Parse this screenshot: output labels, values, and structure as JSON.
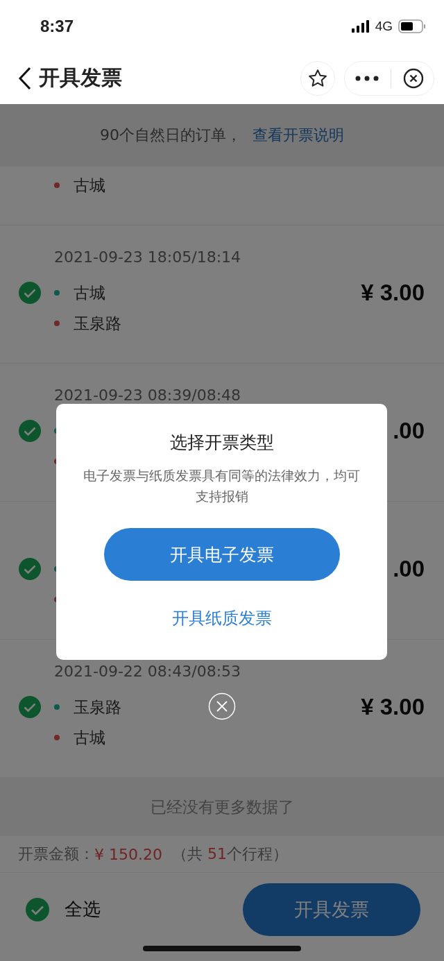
{
  "status_bar": {
    "time": "8:37",
    "network": "4G"
  },
  "nav": {
    "title": "开具发票"
  },
  "notice": {
    "text": "90个自然日的订单，",
    "link": "查看开票说明"
  },
  "trips": [
    {
      "stops": [
        {
          "kind": "end",
          "name": "古城"
        }
      ]
    },
    {
      "checked": true,
      "date": "2021-09-23 18:05/18:14",
      "stops": [
        {
          "kind": "start",
          "name": "古城"
        },
        {
          "kind": "end",
          "name": "玉泉路"
        }
      ],
      "price": "¥ 3.00"
    },
    {
      "checked": true,
      "date": "2021-09-23 08:39/08:48",
      "stops": [
        {
          "kind": "start"
        },
        {
          "kind": "end"
        }
      ],
      "price": ".00"
    },
    {
      "checked": true,
      "stops": [
        {
          "kind": "start"
        },
        {
          "kind": "end"
        }
      ],
      "price": ".00"
    },
    {
      "checked": true,
      "date": "2021-09-22 08:43/08:53",
      "stops": [
        {
          "kind": "start",
          "name": "玉泉路"
        },
        {
          "kind": "end",
          "name": "古城"
        }
      ],
      "price": "¥ 3.00"
    }
  ],
  "end_note": "已经没有更多数据了",
  "summary": {
    "label": "开票金额：",
    "amount": "¥ 150.20",
    "count_prefix": "（共 ",
    "count": "51",
    "count_suffix": "个行程）"
  },
  "bottom_bar": {
    "select_all": {
      "label": "全选",
      "checked": true
    },
    "submit": "开具发票"
  },
  "dialog": {
    "title": "选择开票类型",
    "description": "电子发票与纸质发票具有同等的法律效力，均可支持报销",
    "primary": "开具电子发票",
    "secondary": "开具纸质发票"
  }
}
